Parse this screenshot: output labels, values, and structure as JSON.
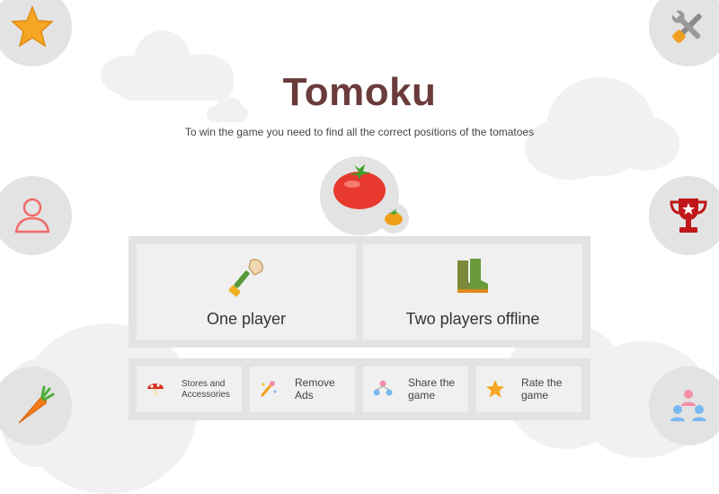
{
  "app": {
    "title": "Tomoku",
    "subtitle": "To win the game you need to find all the correct positions of the tomatoes"
  },
  "corners": {
    "top_left": "star-icon",
    "top_right": "settings-tools-icon",
    "mid_left": "profile-icon",
    "mid_right": "trophy-icon",
    "bottom_left": "carrot-icon",
    "bottom_right": "community-icon"
  },
  "modes": {
    "one_player": "One player",
    "two_players_offline": "Two players offline"
  },
  "actions": {
    "stores": "Stores and Accessories",
    "remove_ads": "Remove Ads",
    "share": "Share the game",
    "rate": "Rate the game"
  },
  "colors": {
    "title": "#6b3b3b",
    "bubble": "#e3e3e3",
    "button": "#f0f0f0"
  }
}
